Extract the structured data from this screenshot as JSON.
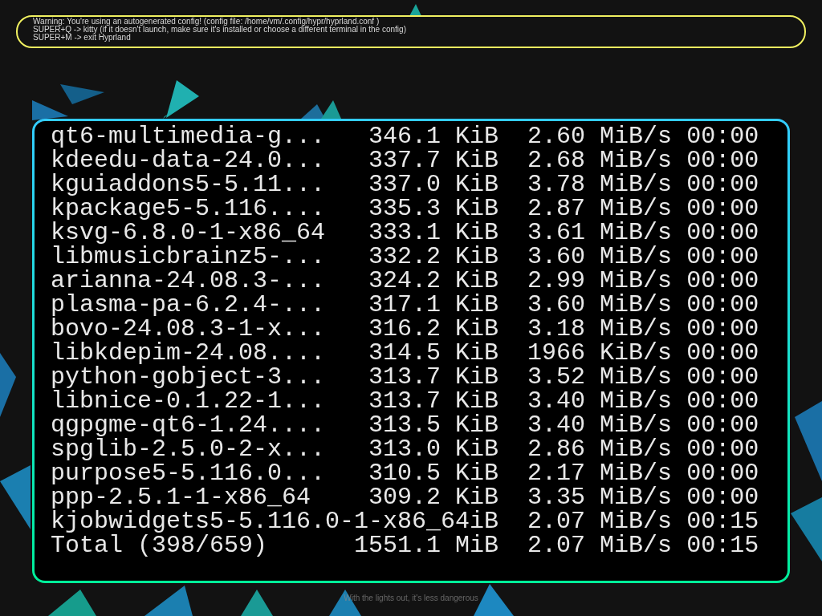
{
  "notification": {
    "lines": [
      "Warning: You're using an autogenerated config! (config file: /home/vm/.config/hypr/hyprland.conf )",
      "SUPER+Q -> kitty (if it doesn't launch, make sure it's installed or choose a different terminal in the config)",
      "SUPER+M -> exit Hyprland"
    ]
  },
  "terminal": {
    "lines": [
      "qt6-multimedia-g...   346.1 KiB  2.60 MiB/s 00:00",
      "kdeedu-data-24.0...   337.7 KiB  2.68 MiB/s 00:00",
      "kguiaddons5-5.11...   337.0 KiB  3.78 MiB/s 00:00",
      "kpackage5-5.116....   335.3 KiB  2.87 MiB/s 00:00",
      "ksvg-6.8.0-1-x86_64   333.1 KiB  3.61 MiB/s 00:00",
      "libmusicbrainz5-...   332.2 KiB  3.60 MiB/s 00:00",
      "arianna-24.08.3-...   324.2 KiB  2.99 MiB/s 00:00",
      "plasma-pa-6.2.4-...   317.1 KiB  3.60 MiB/s 00:00",
      "bovo-24.08.3-1-x...   316.2 KiB  3.18 MiB/s 00:00",
      "libkdepim-24.08....   314.5 KiB  1966 KiB/s 00:00",
      "python-gobject-3...   313.7 KiB  3.52 MiB/s 00:00",
      "libnice-0.1.22-1...   313.7 KiB  3.40 MiB/s 00:00",
      "qgpgme-qt6-1.24....   313.5 KiB  3.40 MiB/s 00:00",
      "spglib-2.5.0-2-x...   313.0 KiB  2.86 MiB/s 00:00",
      "purpose5-5.116.0...   310.5 KiB  2.17 MiB/s 00:00",
      "ppp-2.5.1-1-x86_64    309.2 KiB  3.35 MiB/s 00:00",
      "kjobwidgets5-5.116.0-1-x86_64iB  2.07 MiB/s 00:15",
      "Total (398/659)      1551.1 MiB  2.07 MiB/s 00:15"
    ]
  },
  "splash": "With the lights out, it's less dangerous"
}
